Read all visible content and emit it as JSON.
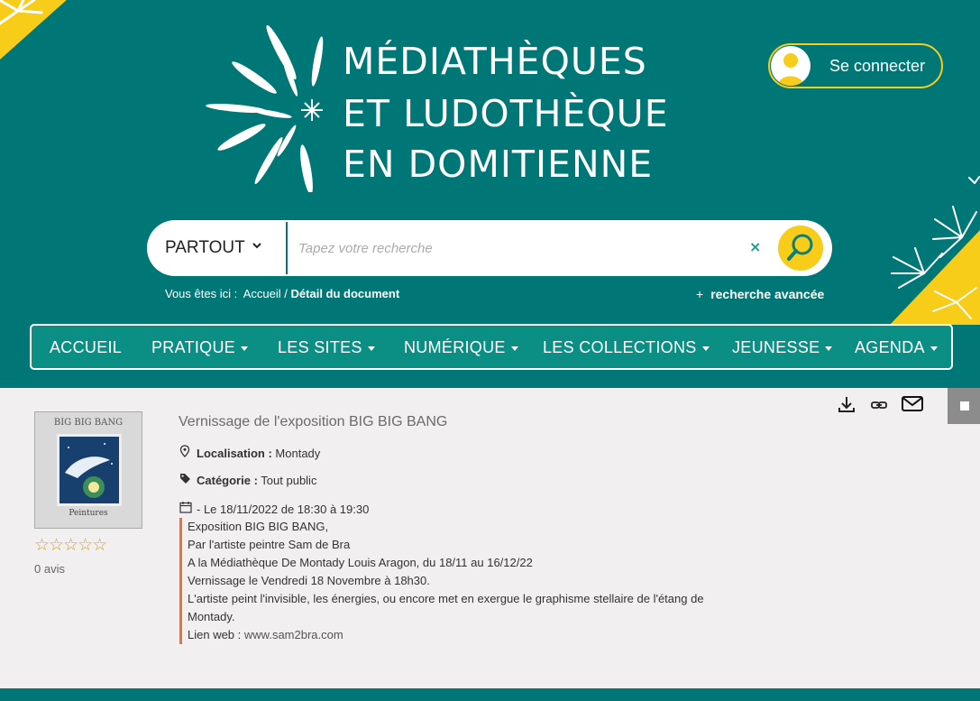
{
  "brand": {
    "line1": "MÉDIATHÈQUES",
    "line2": "ET LUDOTHÈQUE",
    "line3": "EN DOMITIENNE",
    "colors": {
      "teal": "#007777",
      "yellow": "#f7cd1a",
      "accent": "#e8733a"
    }
  },
  "login": {
    "label": "Se connecter",
    "icon": "user-icon"
  },
  "search": {
    "scope": "PARTOUT",
    "placeholder": "Tapez votre recherche",
    "clear": "×",
    "button_icon": "search-icon"
  },
  "breadcrumb": {
    "prefix": "Vous êtes ici :",
    "home": "Accueil",
    "separator": "/",
    "current": "Détail du document"
  },
  "advanced_search": {
    "plus": "+",
    "label": "recherche avancée"
  },
  "nav": {
    "items": [
      {
        "label": "ACCUEIL",
        "dropdown": false
      },
      {
        "label": "PRATIQUE",
        "dropdown": true
      },
      {
        "label": "LES SITES",
        "dropdown": true
      },
      {
        "label": "NUMÉRIQUE",
        "dropdown": true
      },
      {
        "label": "LES COLLECTIONS",
        "dropdown": true
      },
      {
        "label": "JEUNESSE",
        "dropdown": true
      },
      {
        "label": "AGENDA",
        "dropdown": true
      }
    ]
  },
  "document": {
    "thumbnail": {
      "title": "BIG BIG BANG",
      "caption": "Peintures"
    },
    "rating": {
      "stars": "☆☆☆☆☆",
      "value": 0,
      "count_label": "0 avis"
    },
    "title": "Vernissage de l'exposition BIG BIG BANG",
    "location_label": "Localisation :",
    "location_value": "Montady",
    "category_label": "Catégorie :",
    "category_value": "Tout public",
    "date": "- Le 18/11/2022 de 18:30 à 19:30",
    "description": [
      "Exposition BIG BIG BANG,",
      "Par l'artiste peintre Sam de Bra",
      "A la Médiathèque De Montady Louis Aragon, du 18/11 au 16/12/22",
      "Vernissage le Vendredi 18 Novembre à 18h30.",
      "L'artiste peint l'invisible, les énergies, ou encore met en exergue le graphisme stellaire de l'étang de",
      "Montady."
    ],
    "link_label": "Lien web :",
    "link_value": "www.sam2bra.com",
    "tools": [
      "download-icon",
      "link-icon",
      "mail-icon"
    ]
  }
}
